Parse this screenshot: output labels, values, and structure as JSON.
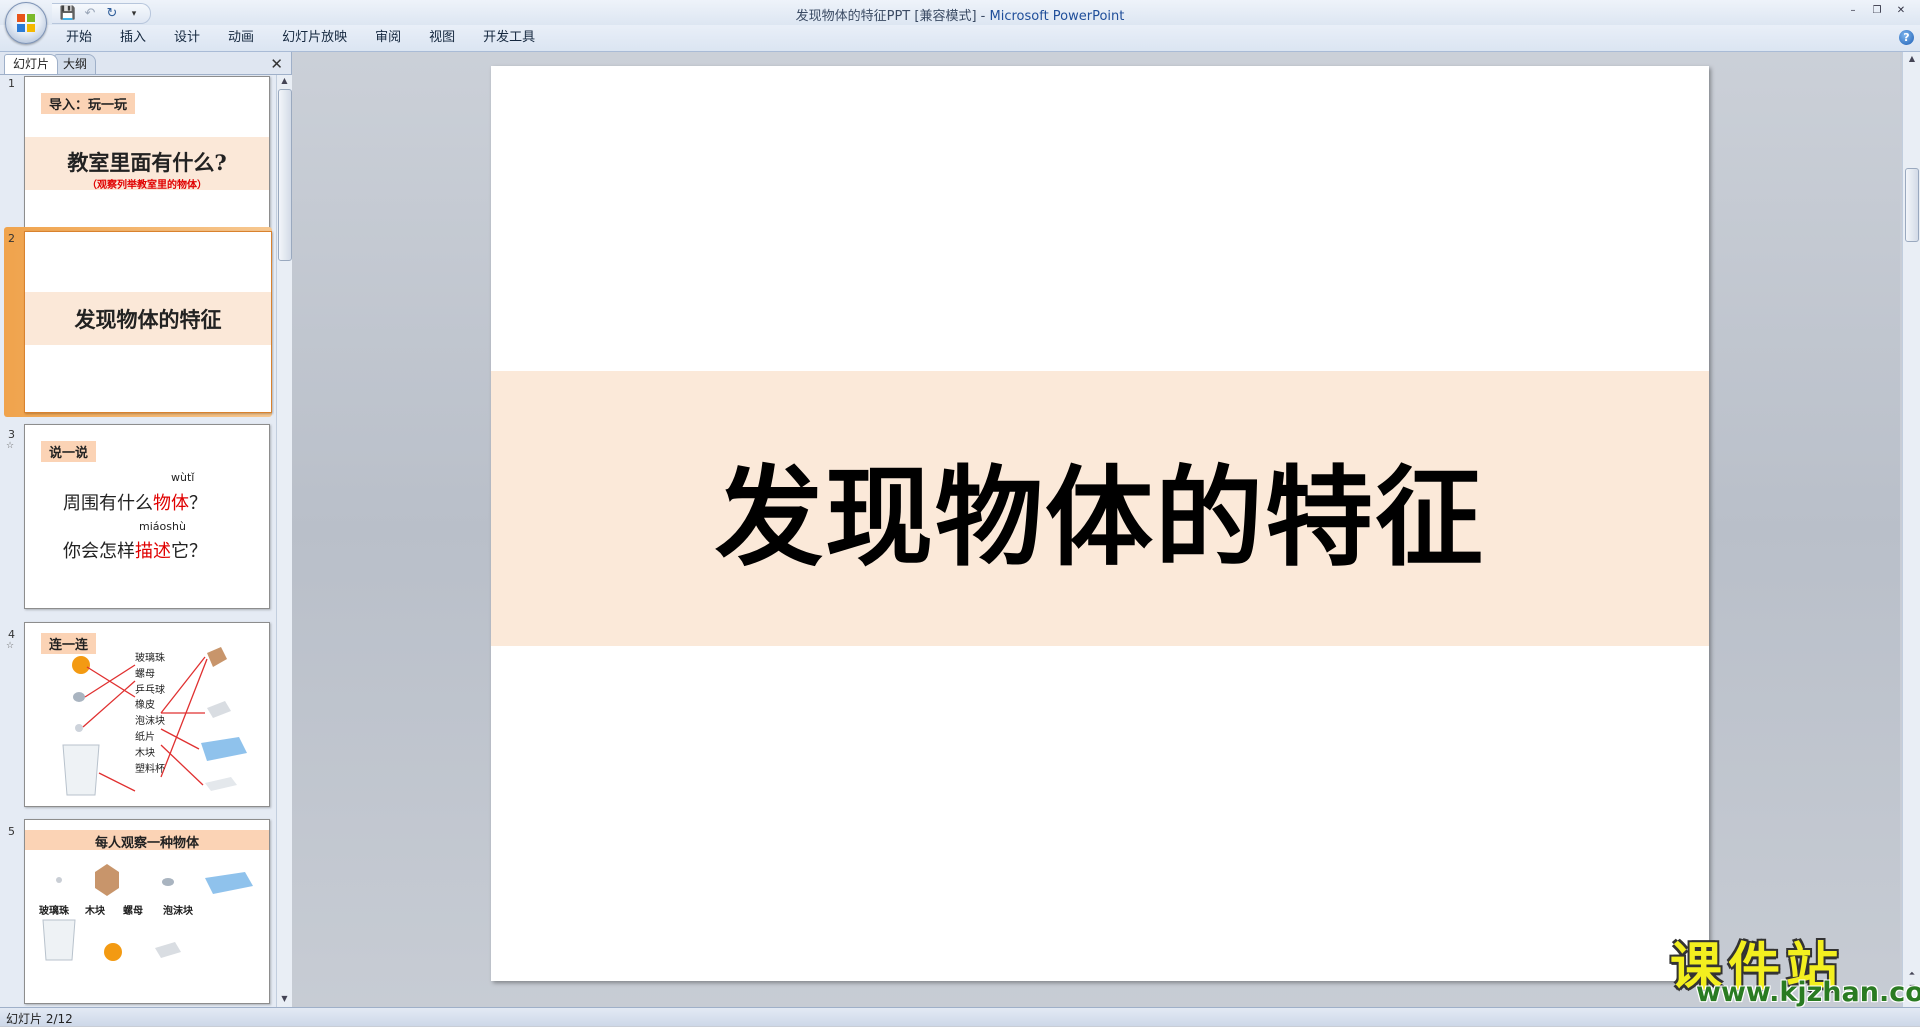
{
  "window": {
    "title": "发现物体的特征PPT [兼容模式]",
    "separator": " - ",
    "app": "Microsoft PowerPoint",
    "controls": [
      "–",
      "❐",
      "✕"
    ]
  },
  "qat": {
    "save_icon": "💾",
    "undo_icon": "↶",
    "redo_icon": "↻",
    "more_icon": "▾"
  },
  "ribbon": {
    "tabs": [
      "开始",
      "插入",
      "设计",
      "动画",
      "幻灯片放映",
      "审阅",
      "视图",
      "开发工具"
    ],
    "help": "?"
  },
  "pane": {
    "tabs": [
      "幻灯片",
      "大纲"
    ],
    "close": "✕",
    "slides": [
      {
        "num": "1",
        "tag": "导入：玩一玩",
        "title": "教室里面有什么?",
        "subtitle": "（观察列举教室里的物体）"
      },
      {
        "num": "2",
        "title": "发现物体的特征"
      },
      {
        "num": "3",
        "tag": "说一说",
        "line1_pre": "周围有什么",
        "line1_red": "物体",
        "line1_post": "？",
        "pinyin1": "wùtǐ",
        "line2_pre": "你会怎样",
        "line2_red": "描述",
        "line2_post": "它？",
        "pinyin2": "miáoshù"
      },
      {
        "num": "4",
        "tag": "连一连",
        "labels": [
          "玻璃珠",
          "螺母",
          "乒乓球",
          "橡皮",
          "泡沫块",
          "纸片",
          "木块",
          "塑料杯"
        ]
      },
      {
        "num": "5",
        "header": "每人观察一种物体",
        "items": [
          "玻璃珠",
          "木块",
          "螺母",
          "泡沫块"
        ]
      }
    ]
  },
  "slide": {
    "title": "发现物体的特征"
  },
  "status": {
    "text": "幻灯片 2/12"
  },
  "watermark": {
    "cn": "课件站",
    "url": "www.kjzhan.com"
  }
}
